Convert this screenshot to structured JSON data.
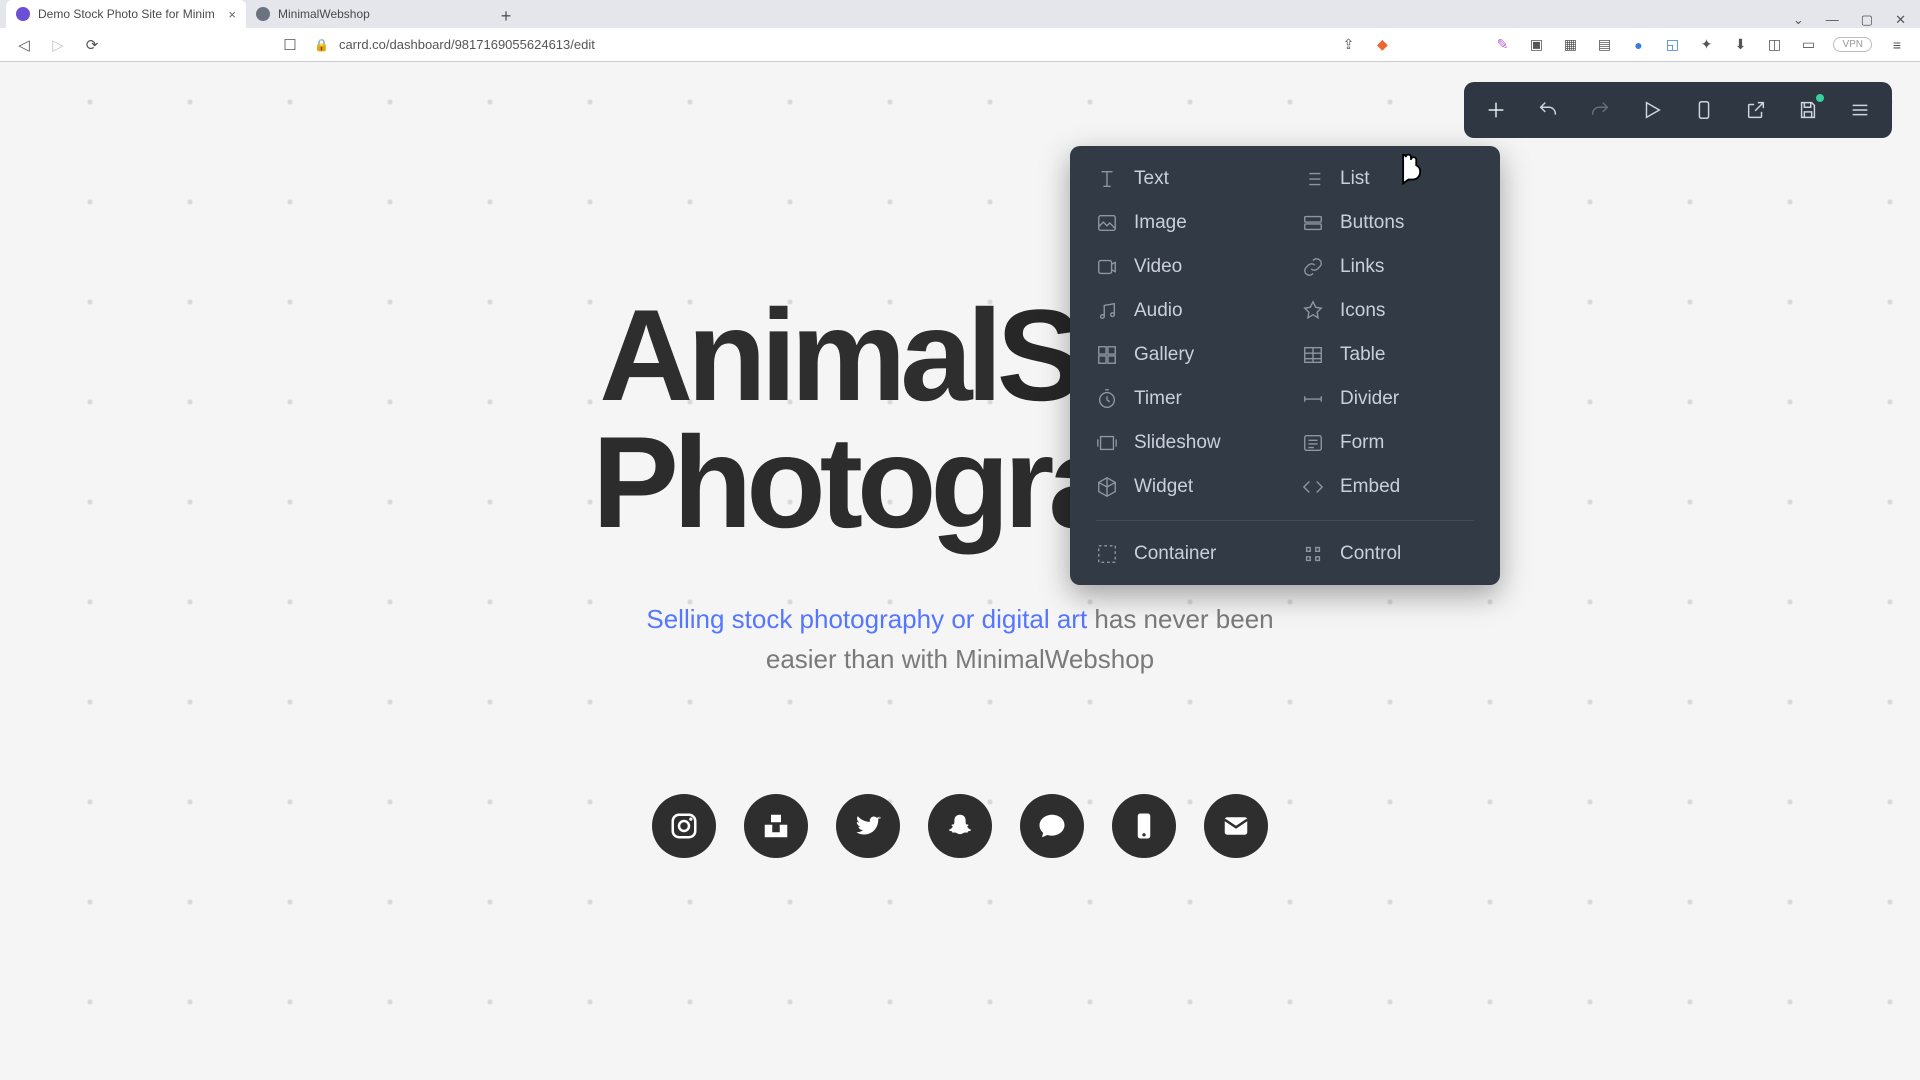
{
  "browser": {
    "tabs": [
      {
        "title": "Demo Stock Photo Site for Minim",
        "active": true
      },
      {
        "title": "MinimalWebshop",
        "active": false
      }
    ],
    "url": "carrd.co/dashboard/9817169055624613/edit",
    "vpn_label": "VPN"
  },
  "page": {
    "headline_part1": "Animal",
    "headline_part2": "Stock",
    "headline_part3": "Photography",
    "subhead_link": "Selling stock photography or digital art",
    "subhead_rest_1": " has never been",
    "subhead_rest_2": "easier than with MinimalWebshop",
    "social_icons": [
      "instagram",
      "unsplash",
      "twitter",
      "snapchat",
      "chat",
      "phone",
      "mail"
    ]
  },
  "toolbar": {
    "buttons": [
      "add",
      "undo",
      "redo",
      "preview",
      "mobile",
      "open",
      "save",
      "menu"
    ]
  },
  "add_panel": {
    "col1": [
      "Text",
      "Image",
      "Video",
      "Audio",
      "Gallery",
      "Timer",
      "Slideshow",
      "Widget"
    ],
    "col2": [
      "List",
      "Buttons",
      "Links",
      "Icons",
      "Table",
      "Divider",
      "Form",
      "Embed"
    ],
    "bottom": [
      "Container",
      "Control"
    ]
  }
}
